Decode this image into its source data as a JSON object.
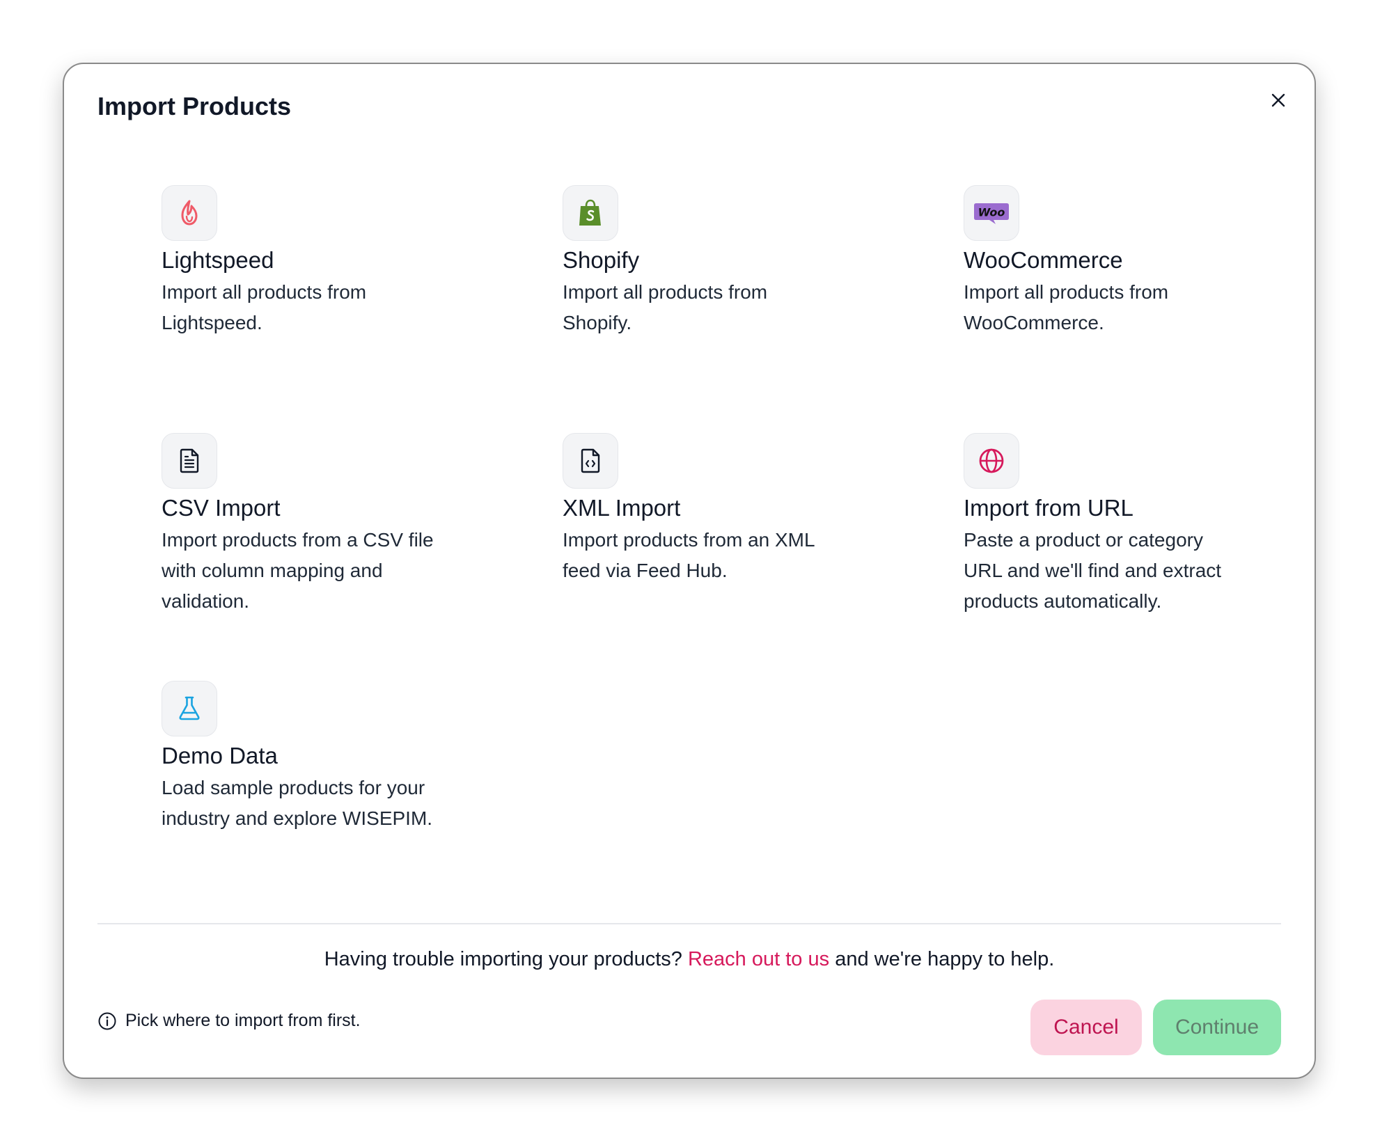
{
  "dialog": {
    "title": "Import Products"
  },
  "sources": [
    {
      "title": "Lightspeed",
      "desc_lines": [
        "Import all products from",
        "Lightspeed."
      ],
      "icon": "lightspeed-flame-icon",
      "icon_color": "#ef5a68"
    },
    {
      "title": "Shopify",
      "desc_lines": [
        "Import all products from",
        "Shopify."
      ],
      "icon": "shopify-bag-icon",
      "icon_color": "#5a8e2a"
    },
    {
      "title": "WooCommerce",
      "desc_lines": [
        "Import all products from",
        "WooCommerce."
      ],
      "icon": "woo-logo-icon",
      "icon_color": "#9b6ccf"
    },
    {
      "title": "CSV Import",
      "desc_lines": [
        "Import products from a CSV file",
        "with column mapping and",
        "validation."
      ],
      "icon": "file-text-icon",
      "icon_color": "#111827"
    },
    {
      "title": "XML Import",
      "desc_lines": [
        "Import products from an XML",
        "feed via Feed Hub."
      ],
      "icon": "file-code-icon",
      "icon_color": "#111827"
    },
    {
      "title": "Import from URL",
      "desc_lines": [
        "Paste a product or category",
        "URL and we'll find and extract",
        "products automatically."
      ],
      "icon": "globe-icon",
      "icon_color": "#d6195b"
    },
    {
      "title": "Demo Data",
      "desc_lines": [
        "Load sample products for your",
        "industry and explore WISEPIM."
      ],
      "icon": "flask-icon",
      "icon_color": "#1aa3e0"
    }
  ],
  "help": {
    "prefix": "Having trouble importing your products?",
    "link": "Reach out to us",
    "suffix": "and we're happy to help."
  },
  "footer": {
    "hint": "Pick where to import from first.",
    "cancel_label": "Cancel",
    "continue_label": "Continue"
  },
  "colors": {
    "accent": "#d6195b",
    "cancel_bg": "#fbd3e0",
    "continue_bg": "#8ee6b0"
  },
  "woo_logo_text": "Woo"
}
